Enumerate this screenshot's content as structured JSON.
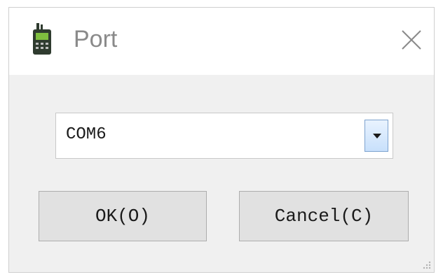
{
  "window": {
    "title": "Port",
    "icon": "walkie-talkie-icon",
    "close_icon": "close-icon"
  },
  "port_select": {
    "value": "COM6",
    "icon": "chevron-down-icon",
    "accent": "#c8e0fb"
  },
  "buttons": {
    "ok_label": "OK(O)",
    "cancel_label": "Cancel(C)"
  }
}
